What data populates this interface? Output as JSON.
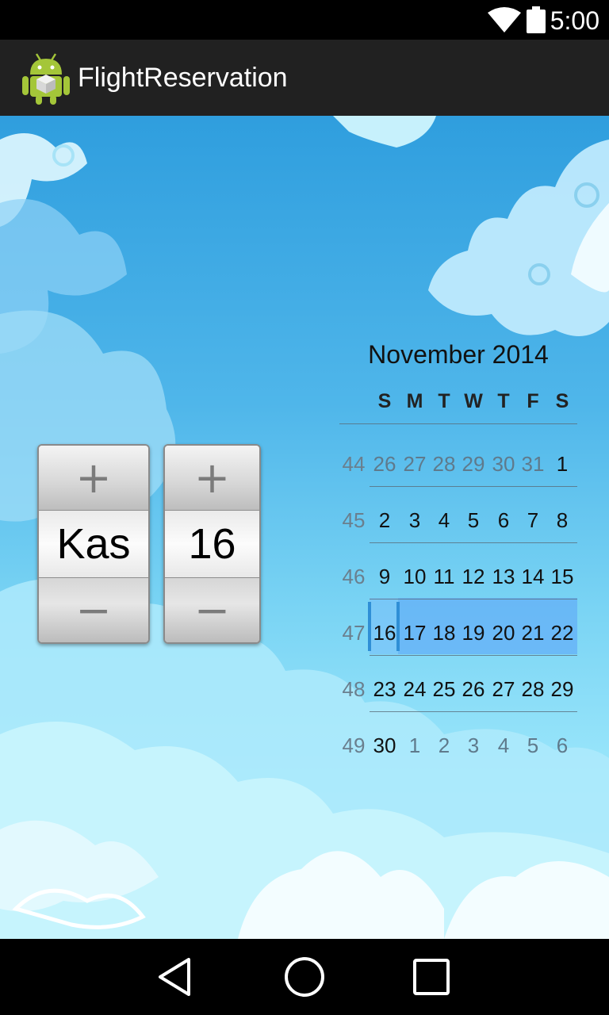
{
  "status_bar": {
    "time": "5:00",
    "icons": [
      "wifi-icon",
      "battery-icon"
    ]
  },
  "action_bar": {
    "title": "FlightReservation",
    "icon": "android-app-icon"
  },
  "month_picker": {
    "value": "Kas",
    "increment": "+",
    "decrement": "−"
  },
  "day_picker": {
    "value": "16",
    "increment": "+",
    "decrement": "−"
  },
  "calendar": {
    "title": "November 2014",
    "weekdays": [
      "S",
      "M",
      "T",
      "W",
      "T",
      "F",
      "S"
    ],
    "weeks": [
      {
        "num": "44",
        "days": [
          "26",
          "27",
          "28",
          "29",
          "30",
          "31",
          "1"
        ]
      },
      {
        "num": "45",
        "days": [
          "2",
          "3",
          "4",
          "5",
          "6",
          "7",
          "8"
        ]
      },
      {
        "num": "46",
        "days": [
          "9",
          "10",
          "11",
          "12",
          "13",
          "14",
          "15"
        ]
      },
      {
        "num": "47",
        "days": [
          "16",
          "17",
          "18",
          "19",
          "20",
          "21",
          "22"
        ]
      },
      {
        "num": "48",
        "days": [
          "23",
          "24",
          "25",
          "26",
          "27",
          "28",
          "29"
        ]
      },
      {
        "num": "49",
        "days": [
          "30",
          "1",
          "2",
          "3",
          "4",
          "5",
          "6"
        ]
      }
    ],
    "selected_date": "16"
  },
  "nav_bar": {
    "buttons": [
      "back-icon",
      "home-icon",
      "recents-icon"
    ]
  }
}
